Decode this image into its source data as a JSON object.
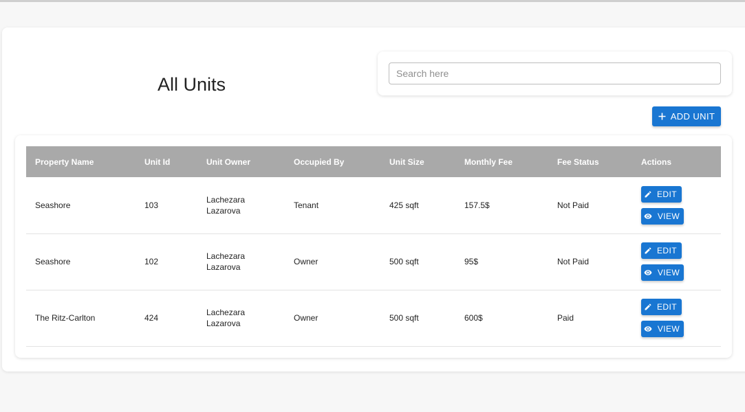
{
  "page": {
    "title": "All Units"
  },
  "search": {
    "placeholder": "Search here",
    "value": ""
  },
  "toolbar": {
    "add_unit_label": "ADD UNIT",
    "add_icon": "plus-icon"
  },
  "table": {
    "columns": [
      "Property Name",
      "Unit Id",
      "Unit Owner",
      "Occupied By",
      "Unit Size",
      "Monthly Fee",
      "Fee Status",
      "Actions"
    ],
    "rows": [
      {
        "property": "Seashore",
        "unit_id": "103",
        "owner_first": "Lachezara",
        "owner_last": "Lazarova",
        "occupied_by": "Tenant",
        "size": "425 sqft",
        "fee": "157.5$",
        "status": "Not Paid"
      },
      {
        "property": "Seashore",
        "unit_id": "102",
        "owner_first": "Lachezara",
        "owner_last": "Lazarova",
        "occupied_by": "Owner",
        "size": "500 sqft",
        "fee": "95$",
        "status": "Not Paid"
      },
      {
        "property": "The Ritz-Carlton",
        "unit_id": "424",
        "owner_first": "Lachezara",
        "owner_last": "Lazarova",
        "occupied_by": "Owner",
        "size": "500 sqft",
        "fee": "600$",
        "status": "Paid"
      }
    ],
    "actions": {
      "edit_label": "EDIT",
      "view_label": "VIEW",
      "edit_icon": "pencil-icon",
      "view_icon": "eye-icon"
    }
  },
  "colors": {
    "primary": "#1976d2",
    "header_bg": "#a9a9a9",
    "not_paid": "#e0201a",
    "paid": "#208a20"
  }
}
